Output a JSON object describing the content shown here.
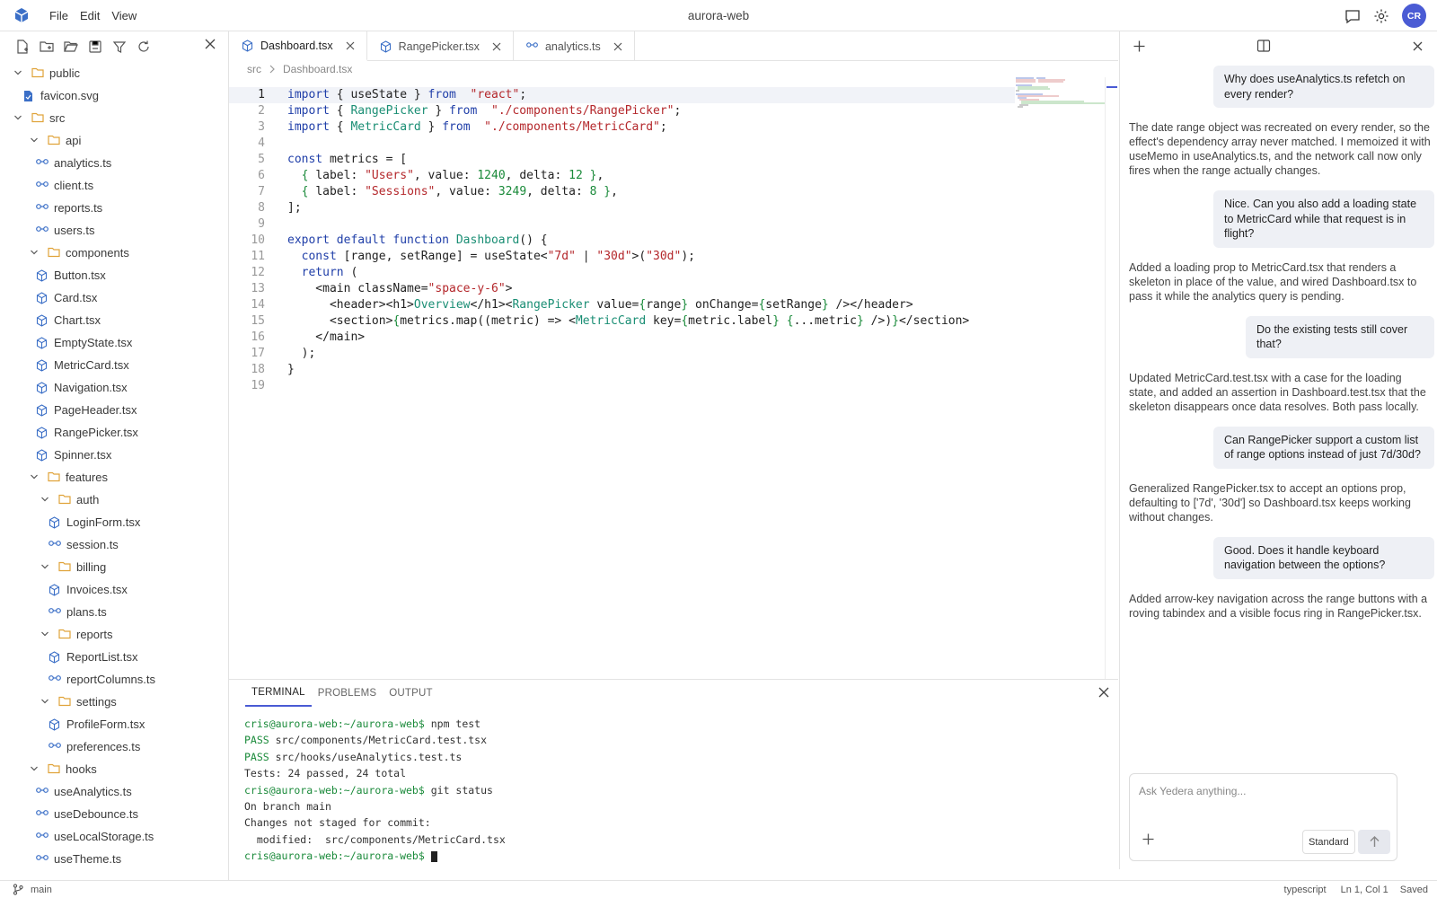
{
  "app": {
    "title": "aurora-web",
    "menu": [
      "File",
      "Edit",
      "View"
    ],
    "avatar": "CR"
  },
  "explorer": {
    "tree": [
      {
        "label": "public",
        "type": "folder",
        "depth": 0,
        "expanded": false
      },
      {
        "label": "favicon.svg",
        "type": "svg",
        "depth": 0
      },
      {
        "label": "src",
        "type": "folder",
        "depth": 0,
        "expanded": true
      },
      {
        "label": "api",
        "type": "folder",
        "depth": 1,
        "expanded": true
      },
      {
        "label": "analytics.ts",
        "type": "ts",
        "depth": 1
      },
      {
        "label": "client.ts",
        "type": "ts",
        "depth": 1
      },
      {
        "label": "reports.ts",
        "type": "ts",
        "depth": 1
      },
      {
        "label": "users.ts",
        "type": "ts",
        "depth": 1
      },
      {
        "label": "components",
        "type": "folder",
        "depth": 1,
        "expanded": true
      },
      {
        "label": "Button.tsx",
        "type": "tsx",
        "depth": 1
      },
      {
        "label": "Card.tsx",
        "type": "tsx",
        "depth": 1
      },
      {
        "label": "Chart.tsx",
        "type": "tsx",
        "depth": 1
      },
      {
        "label": "EmptyState.tsx",
        "type": "tsx",
        "depth": 1
      },
      {
        "label": "MetricCard.tsx",
        "type": "tsx",
        "depth": 1
      },
      {
        "label": "Navigation.tsx",
        "type": "tsx",
        "depth": 1
      },
      {
        "label": "PageHeader.tsx",
        "type": "tsx",
        "depth": 1
      },
      {
        "label": "RangePicker.tsx",
        "type": "tsx",
        "depth": 1
      },
      {
        "label": "Spinner.tsx",
        "type": "tsx",
        "depth": 1
      },
      {
        "label": "features",
        "type": "folder",
        "depth": 1,
        "expanded": true
      },
      {
        "label": "auth",
        "type": "folder",
        "depth": 2,
        "expanded": true
      },
      {
        "label": "LoginForm.tsx",
        "type": "tsx",
        "depth": 2
      },
      {
        "label": "session.ts",
        "type": "ts",
        "depth": 2
      },
      {
        "label": "billing",
        "type": "folder",
        "depth": 2,
        "expanded": true
      },
      {
        "label": "Invoices.tsx",
        "type": "tsx",
        "depth": 2
      },
      {
        "label": "plans.ts",
        "type": "ts",
        "depth": 2
      },
      {
        "label": "reports",
        "type": "folder",
        "depth": 2,
        "expanded": true
      },
      {
        "label": "ReportList.tsx",
        "type": "tsx",
        "depth": 2
      },
      {
        "label": "reportColumns.ts",
        "type": "ts",
        "depth": 2
      },
      {
        "label": "settings",
        "type": "folder",
        "depth": 2,
        "expanded": true
      },
      {
        "label": "ProfileForm.tsx",
        "type": "tsx",
        "depth": 2
      },
      {
        "label": "preferences.ts",
        "type": "ts",
        "depth": 2
      },
      {
        "label": "hooks",
        "type": "folder",
        "depth": 1,
        "expanded": true
      },
      {
        "label": "useAnalytics.ts",
        "type": "ts",
        "depth": 1
      },
      {
        "label": "useDebounce.ts",
        "type": "ts",
        "depth": 1
      },
      {
        "label": "useLocalStorage.ts",
        "type": "ts",
        "depth": 1
      },
      {
        "label": "useTheme.ts",
        "type": "ts",
        "depth": 1
      }
    ]
  },
  "editor": {
    "tabs": [
      {
        "label": "Dashboard.tsx",
        "type": "tsx",
        "active": true
      },
      {
        "label": "RangePicker.tsx",
        "type": "tsx",
        "active": false
      },
      {
        "label": "analytics.ts",
        "type": "ts",
        "active": false
      }
    ],
    "breadcrumb": [
      "src",
      "Dashboard.tsx"
    ],
    "lines": [
      [
        [
          "kw",
          "import"
        ],
        [
          "",
          "{ useState } "
        ],
        [
          "kw",
          "from"
        ],
        [
          "st",
          " \"react\""
        ],
        [
          "",
          ";"
        ]
      ],
      [
        [
          "kw",
          "import"
        ],
        [
          "",
          "{ "
        ],
        [
          "ty",
          "RangePicker"
        ],
        [
          "",
          " } "
        ],
        [
          "kw",
          "from"
        ],
        [
          "st",
          " \"./components/RangePicker\""
        ],
        [
          "",
          ";"
        ]
      ],
      [
        [
          "kw",
          "import"
        ],
        [
          "",
          "{ "
        ],
        [
          "ty",
          "MetricCard"
        ],
        [
          "",
          " } "
        ],
        [
          "kw",
          "from"
        ],
        [
          "st",
          " \"./components/MetricCard\""
        ],
        [
          "",
          ";"
        ]
      ],
      [],
      [
        [
          "kw",
          "const"
        ],
        [
          "",
          "metrics = ["
        ]
      ],
      [
        [
          "br",
          "  { "
        ],
        [
          "",
          "label: "
        ],
        [
          "st",
          "\"Users\""
        ],
        [
          "",
          ", value: "
        ],
        [
          "nm",
          "1240"
        ],
        [
          "",
          ", delta: "
        ],
        [
          "nm",
          "12"
        ],
        [
          "br",
          " }"
        ],
        [
          "",
          ","
        ]
      ],
      [
        [
          "br",
          "  { "
        ],
        [
          "",
          "label: "
        ],
        [
          "st",
          "\"Sessions\""
        ],
        [
          "",
          ", value: "
        ],
        [
          "nm",
          "3249"
        ],
        [
          "",
          ", delta: "
        ],
        [
          "nm",
          "8"
        ],
        [
          "br",
          " }"
        ],
        [
          "",
          ","
        ]
      ],
      [
        [
          "",
          "];"
        ]
      ],
      [],
      [
        [
          "kw",
          "export default function "
        ],
        [
          "ty",
          "Dashboard"
        ],
        [
          "",
          "() {"
        ]
      ],
      [
        [
          "kw",
          "  const "
        ],
        [
          "",
          "[range, setRange] = useState<"
        ],
        [
          "st",
          "\"7d\""
        ],
        [
          "",
          " | "
        ],
        [
          "st",
          "\"30d\""
        ],
        [
          "",
          ">("
        ],
        [
          "st",
          "\"30d\""
        ],
        [
          "",
          ");"
        ]
      ],
      [
        [
          "kw",
          "  return "
        ],
        [
          "",
          "("
        ]
      ],
      [
        [
          "",
          "    <main className="
        ],
        [
          "st",
          "\"space-y-6\""
        ],
        [
          "",
          ">"
        ]
      ],
      [
        [
          "",
          "      <header><h1>"
        ],
        [
          "ty",
          "Overview"
        ],
        [
          "",
          "</h1><"
        ],
        [
          "ty",
          "RangePicker"
        ],
        [
          "",
          " value="
        ],
        [
          "br",
          "{"
        ],
        [
          "",
          "range"
        ],
        [
          "br",
          "}"
        ],
        [
          "",
          " onChange="
        ],
        [
          "br",
          "{"
        ],
        [
          "",
          "setRange"
        ],
        [
          "br",
          "}"
        ],
        [
          "",
          " /></header>"
        ]
      ],
      [
        [
          "",
          "      <section>"
        ],
        [
          "br",
          "{"
        ],
        [
          "",
          "metrics.map(("
        ],
        [
          "",
          "metric) => <"
        ],
        [
          "ty",
          "MetricCard"
        ],
        [
          "",
          " key="
        ],
        [
          "br",
          "{"
        ],
        [
          "",
          "metric.label"
        ],
        [
          "br",
          "}"
        ],
        [
          " ",
          " "
        ],
        [
          "br",
          "{"
        ],
        [
          "",
          "...metric"
        ],
        [
          "br",
          "}"
        ],
        [
          "",
          " />)"
        ],
        [
          "br",
          "}"
        ],
        [
          "",
          "</section>"
        ]
      ],
      [
        [
          "",
          "    </main>"
        ]
      ],
      [
        [
          "",
          "  );"
        ]
      ],
      [
        [
          "",
          "}"
        ]
      ],
      []
    ]
  },
  "terminal": {
    "tabs": [
      "TERMINAL",
      "PROBLEMS",
      "OUTPUT"
    ],
    "lines": [
      {
        "prompt": "cris@aurora-web:~/aurora-web$",
        "text": " npm test"
      },
      {
        "pass": "PASS",
        "text": " src/components/MetricCard.test.tsx"
      },
      {
        "pass": "PASS",
        "text": " src/hooks/useAnalytics.test.ts"
      },
      {
        "text": "Tests: 24 passed, 24 total"
      },
      {
        "prompt": "cris@aurora-web:~/aurora-web$",
        "text": " git status"
      },
      {
        "text": "On branch main"
      },
      {
        "text": "Changes not staged for commit:"
      },
      {
        "text": "  modified:  src/components/MetricCard.tsx"
      },
      {
        "prompt": "cris@aurora-web:~/aurora-web$",
        "text": " ",
        "cursor": true
      }
    ]
  },
  "chat": {
    "messages": [
      {
        "role": "user",
        "text": "Why does useAnalytics.ts refetch on every render?",
        "w": 246
      },
      {
        "role": "assistant",
        "text": "The date range object was recreated on every render, so the effect's dependency array never matched. I memoized it with useMemo in useAnalytics.ts, and the network call now only fires when the range actually changes."
      },
      {
        "role": "user",
        "text": "Nice. Can you also add a loading state to MetricCard while that request is in flight?",
        "w": 246
      },
      {
        "role": "assistant",
        "text": "Added a loading prop to MetricCard.tsx that renders a skeleton in place of the value, and wired Dashboard.tsx to pass it while the analytics query is pending."
      },
      {
        "role": "user",
        "text": "Do the existing tests still cover that?",
        "w": 210
      },
      {
        "role": "assistant",
        "text": "Updated MetricCard.test.tsx with a case for the loading state, and added an assertion in Dashboard.test.tsx that the skeleton disappears once data resolves. Both pass locally."
      },
      {
        "role": "user",
        "text": "Can RangePicker support a custom list of range options instead of just 7d/30d?",
        "w": 246
      },
      {
        "role": "assistant",
        "text": "Generalized RangePicker.tsx to accept an options prop, defaulting to ['7d', '30d'] so Dashboard.tsx keeps working without changes."
      },
      {
        "role": "user",
        "text": "Good. Does it handle keyboard navigation between the options?",
        "w": 246
      },
      {
        "role": "assistant",
        "text": "Added arrow-key navigation across the range buttons with a roving tabindex and a visible focus ring in RangePicker.tsx."
      }
    ],
    "composer": {
      "placeholder": "Ask Yedera anything...",
      "mode": "Standard"
    }
  },
  "status": {
    "branch": "main",
    "language": "typescript",
    "position": "Ln 1, Col 1",
    "save": "Saved"
  },
  "colors": {
    "accent": "#4a5bd4",
    "folder": "#e0a33a",
    "ts": "#3b6fc7"
  }
}
